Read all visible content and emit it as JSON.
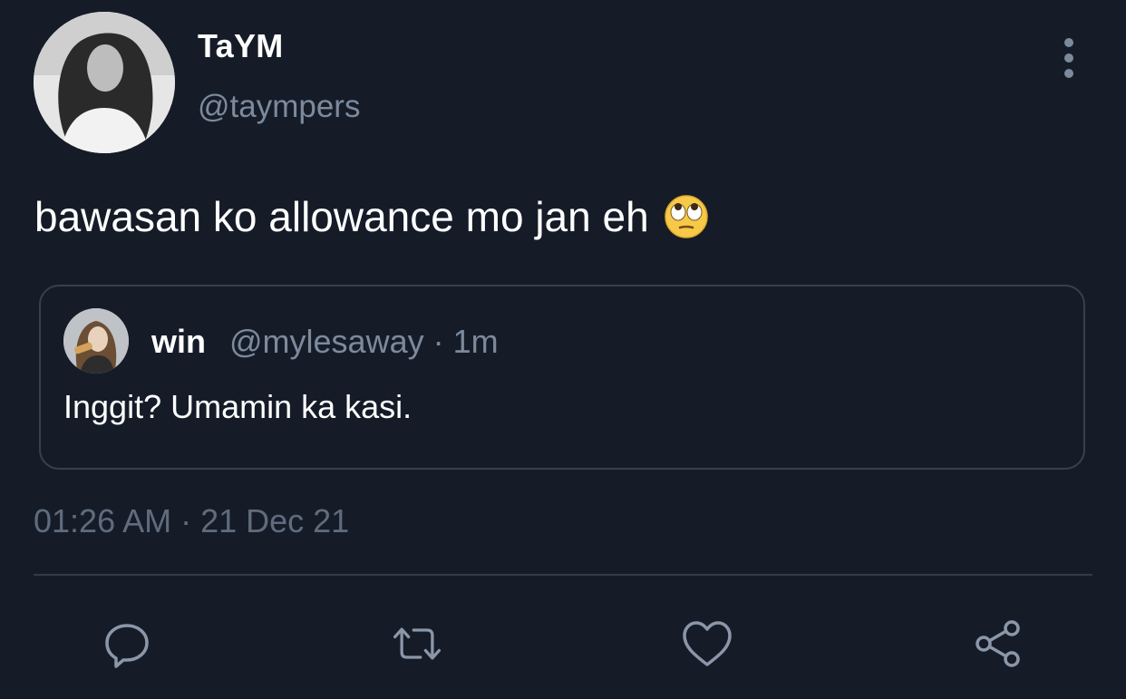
{
  "tweet": {
    "author": {
      "display_name": "TaYM",
      "handle": "@taympers"
    },
    "text": "bawasan ko allowance mo jan eh",
    "emoji": "face-with-rolling-eyes",
    "timestamp": "01:26 AM · 21 Dec 21"
  },
  "quoted_tweet": {
    "author": {
      "display_name": "win"
    },
    "meta": "@mylesaway · 1m",
    "text": "Inggit? Umamin ka kasi."
  },
  "actions": [
    "reply-icon",
    "retweet-icon",
    "like-icon",
    "share-icon"
  ],
  "colors": {
    "background": "#151c28",
    "text_primary": "#ffffff",
    "text_secondary": "#7c8a9c",
    "border": "#38404e"
  }
}
